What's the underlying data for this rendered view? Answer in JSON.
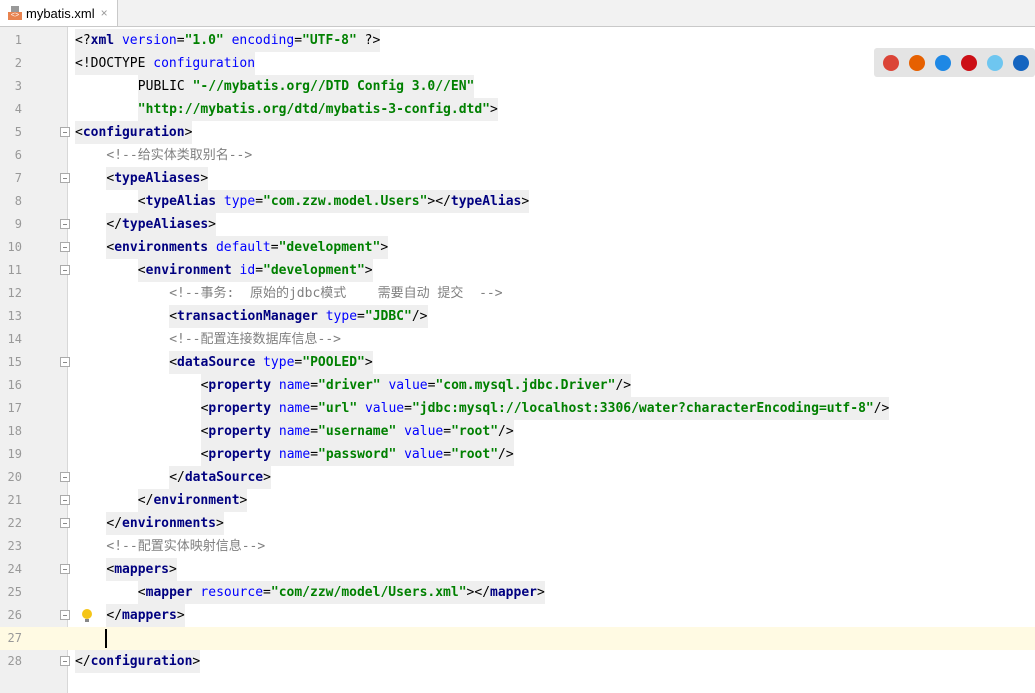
{
  "tab": {
    "title": "mybatis.xml",
    "close": "×"
  },
  "browsers": [
    {
      "name": "chrome-icon",
      "color": "#db4437"
    },
    {
      "name": "firefox-icon",
      "color": "#e66000"
    },
    {
      "name": "safari-icon",
      "color": "#1e88e5"
    },
    {
      "name": "opera-icon",
      "color": "#cc0f16"
    },
    {
      "name": "ie-icon",
      "color": "#6ec6f0"
    },
    {
      "name": "edge-icon",
      "color": "#1565c0"
    }
  ],
  "lines": [
    {
      "n": "1",
      "i": 0,
      "t": [
        [
          "p",
          "<?"
        ],
        [
          "tag",
          "xml "
        ],
        [
          "attr",
          "version"
        ],
        [
          "p",
          "="
        ],
        [
          "val",
          "\"1.0\" "
        ],
        [
          "attr",
          "encoding"
        ],
        [
          "p",
          "="
        ],
        [
          "val",
          "\"UTF-8\" "
        ],
        [
          "p",
          "?>"
        ]
      ]
    },
    {
      "n": "2",
      "i": 0,
      "t": [
        [
          "p",
          "<!DOCTYPE "
        ],
        [
          "attr",
          "configuration"
        ]
      ]
    },
    {
      "n": "3",
      "i": 8,
      "t": [
        [
          "p",
          "PUBLIC "
        ],
        [
          "val",
          "\"-//mybatis.org//DTD Config 3.0//EN\""
        ]
      ]
    },
    {
      "n": "4",
      "i": 8,
      "t": [
        [
          "val",
          "\"http://mybatis.org/dtd/mybatis-3-config.dtd\""
        ],
        [
          "p",
          ">"
        ]
      ]
    },
    {
      "n": "5",
      "i": 0,
      "f": 1,
      "t": [
        [
          "p",
          "<"
        ],
        [
          "tag",
          "configuration"
        ],
        [
          "p",
          ">"
        ]
      ]
    },
    {
      "n": "6",
      "i": 4,
      "t": [
        [
          "cm",
          "<!--给实体类取别名-->"
        ]
      ]
    },
    {
      "n": "7",
      "i": 4,
      "f": 1,
      "t": [
        [
          "p",
          "<"
        ],
        [
          "tag",
          "typeAliases"
        ],
        [
          "p",
          ">"
        ]
      ]
    },
    {
      "n": "8",
      "i": 8,
      "t": [
        [
          "p",
          "<"
        ],
        [
          "tag",
          "typeAlias "
        ],
        [
          "attr",
          "type"
        ],
        [
          "p",
          "="
        ],
        [
          "val",
          "\"com.zzw.model.Users\""
        ],
        [
          "p",
          "></"
        ],
        [
          "tag",
          "typeAlias"
        ],
        [
          "p",
          ">"
        ]
      ]
    },
    {
      "n": "9",
      "i": 4,
      "f": 1,
      "t": [
        [
          "p",
          "</"
        ],
        [
          "tag",
          "typeAliases"
        ],
        [
          "p",
          ">"
        ]
      ]
    },
    {
      "n": "10",
      "i": 4,
      "f": 1,
      "t": [
        [
          "p",
          "<"
        ],
        [
          "tag",
          "environments "
        ],
        [
          "attr",
          "default"
        ],
        [
          "p",
          "="
        ],
        [
          "val",
          "\"development\""
        ],
        [
          "p",
          ">"
        ]
      ]
    },
    {
      "n": "11",
      "i": 8,
      "f": 1,
      "t": [
        [
          "p",
          "<"
        ],
        [
          "tag",
          "environment "
        ],
        [
          "attr",
          "id"
        ],
        [
          "p",
          "="
        ],
        [
          "val",
          "\"development\""
        ],
        [
          "p",
          ">"
        ]
      ]
    },
    {
      "n": "12",
      "i": 12,
      "t": [
        [
          "cm",
          "<!--事务:  原始的jdbc模式    需要自动 提交  -->"
        ]
      ]
    },
    {
      "n": "13",
      "i": 12,
      "t": [
        [
          "p",
          "<"
        ],
        [
          "tag",
          "transactionManager "
        ],
        [
          "attr",
          "type"
        ],
        [
          "p",
          "="
        ],
        [
          "val",
          "\"JDBC\""
        ],
        [
          "p",
          "/>"
        ]
      ]
    },
    {
      "n": "14",
      "i": 12,
      "t": [
        [
          "cm",
          "<!--配置连接数据库信息-->"
        ]
      ]
    },
    {
      "n": "15",
      "i": 12,
      "f": 1,
      "t": [
        [
          "p",
          "<"
        ],
        [
          "tag",
          "dataSource "
        ],
        [
          "attr",
          "type"
        ],
        [
          "p",
          "="
        ],
        [
          "val",
          "\"POOLED\""
        ],
        [
          "p",
          ">"
        ]
      ]
    },
    {
      "n": "16",
      "i": 16,
      "t": [
        [
          "p",
          "<"
        ],
        [
          "tag",
          "property "
        ],
        [
          "attr",
          "name"
        ],
        [
          "p",
          "="
        ],
        [
          "val",
          "\"driver\" "
        ],
        [
          "attr",
          "value"
        ],
        [
          "p",
          "="
        ],
        [
          "val",
          "\"com.mysql.jdbc.Driver\""
        ],
        [
          "p",
          "/>"
        ]
      ]
    },
    {
      "n": "17",
      "i": 16,
      "t": [
        [
          "p",
          "<"
        ],
        [
          "tag",
          "property "
        ],
        [
          "attr",
          "name"
        ],
        [
          "p",
          "="
        ],
        [
          "val",
          "\"url\" "
        ],
        [
          "attr",
          "value"
        ],
        [
          "p",
          "="
        ],
        [
          "val",
          "\"jdbc:mysql://localhost:3306/water?characterEncoding=utf-8\""
        ],
        [
          "p",
          "/>"
        ]
      ]
    },
    {
      "n": "18",
      "i": 16,
      "t": [
        [
          "p",
          "<"
        ],
        [
          "tag",
          "property "
        ],
        [
          "attr",
          "name"
        ],
        [
          "p",
          "="
        ],
        [
          "val",
          "\"username\" "
        ],
        [
          "attr",
          "value"
        ],
        [
          "p",
          "="
        ],
        [
          "val",
          "\"root\""
        ],
        [
          "p",
          "/>"
        ]
      ]
    },
    {
      "n": "19",
      "i": 16,
      "t": [
        [
          "p",
          "<"
        ],
        [
          "tag",
          "property "
        ],
        [
          "attr",
          "name"
        ],
        [
          "p",
          "="
        ],
        [
          "val",
          "\"password\" "
        ],
        [
          "attr",
          "value"
        ],
        [
          "p",
          "="
        ],
        [
          "val",
          "\"root\""
        ],
        [
          "p",
          "/>"
        ]
      ]
    },
    {
      "n": "20",
      "i": 12,
      "f": 1,
      "t": [
        [
          "p",
          "</"
        ],
        [
          "tag",
          "dataSource"
        ],
        [
          "p",
          ">"
        ]
      ]
    },
    {
      "n": "21",
      "i": 8,
      "f": 1,
      "t": [
        [
          "p",
          "</"
        ],
        [
          "tag",
          "environment"
        ],
        [
          "p",
          ">"
        ]
      ]
    },
    {
      "n": "22",
      "i": 4,
      "f": 1,
      "t": [
        [
          "p",
          "</"
        ],
        [
          "tag",
          "environments"
        ],
        [
          "p",
          ">"
        ]
      ]
    },
    {
      "n": "23",
      "i": 4,
      "t": [
        [
          "cm",
          "<!--配置实体映射信息-->"
        ]
      ]
    },
    {
      "n": "24",
      "i": 4,
      "f": 1,
      "t": [
        [
          "p",
          "<"
        ],
        [
          "tag",
          "mappers"
        ],
        [
          "p",
          ">"
        ]
      ]
    },
    {
      "n": "25",
      "i": 8,
      "t": [
        [
          "p",
          "<"
        ],
        [
          "tag",
          "mapper "
        ],
        [
          "attr",
          "resource"
        ],
        [
          "p",
          "="
        ],
        [
          "val",
          "\"com/zzw/model/Users.xml\""
        ],
        [
          "p",
          "></"
        ],
        [
          "tag",
          "mapper"
        ],
        [
          "p",
          ">"
        ]
      ]
    },
    {
      "n": "26",
      "i": 4,
      "f": 1,
      "b": 1,
      "t": [
        [
          "p",
          "</"
        ],
        [
          "tag",
          "mappers"
        ],
        [
          "p",
          ">"
        ]
      ]
    },
    {
      "n": "27",
      "i": 4,
      "cur": 1,
      "t": []
    },
    {
      "n": "28",
      "i": 0,
      "f": 1,
      "t": [
        [
          "p",
          "</"
        ],
        [
          "tag",
          "configuration"
        ],
        [
          "p",
          ">"
        ]
      ]
    }
  ]
}
